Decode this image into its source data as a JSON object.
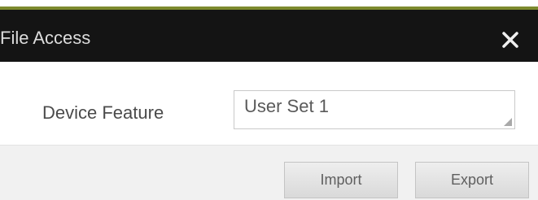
{
  "dialog": {
    "title": "File Access",
    "close_icon": "close-icon"
  },
  "form": {
    "device_feature_label": "Device Feature",
    "device_feature_value": "User Set 1"
  },
  "footer": {
    "import_label": "Import",
    "export_label": "Export"
  },
  "colors": {
    "title_bar": "#141414",
    "accent": "#7d8a2e",
    "content_bg": "#ffffff",
    "footer_bg": "#f1f1f1"
  }
}
